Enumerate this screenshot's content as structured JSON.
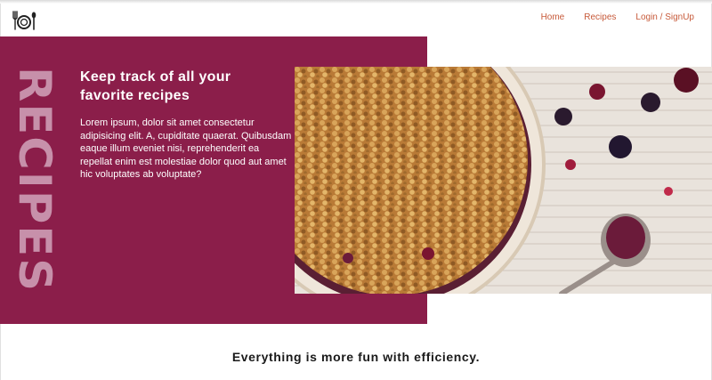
{
  "header": {
    "logo_icon": "fork-plate-spoon-icon",
    "nav": [
      {
        "label": "Home"
      },
      {
        "label": "Recipes"
      },
      {
        "label": "Login / SignUp"
      }
    ]
  },
  "hero": {
    "vertical_word": "RECIPES",
    "heading": "Keep track of all your favorite recipes",
    "body": "Lorem ipsum, dolor sit amet consectetur adipisicing elit. A, cupiditate quaerat. Quibusdam eaque illum eveniet nisi, reprehenderit ea repellat enim est molestiae dolor quod aut amet hic voluptates ab voluptate?",
    "image": "berry-crumble-photo",
    "colors": {
      "panel": "#8b1e4a",
      "vertical_word": "#c790aa",
      "nav": "#c75a3a"
    }
  },
  "tagline": "Everything is more fun with efficiency."
}
